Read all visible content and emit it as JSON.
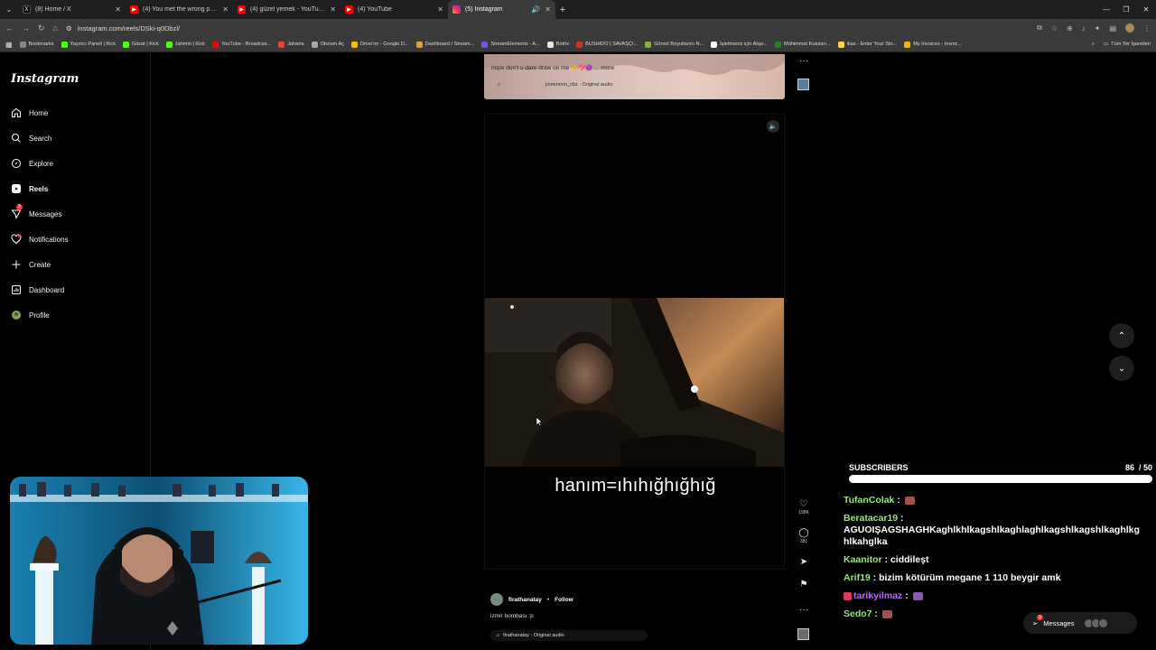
{
  "browser": {
    "tabs": [
      {
        "label": "(8) Home / X",
        "icon": "x-logo-icon",
        "color": "#000000"
      },
      {
        "label": "(4) You met the wrong person.",
        "icon": "youtube-icon",
        "color": "#ff0000"
      },
      {
        "label": "(4) güzel yemek - YouTube",
        "icon": "youtube-icon",
        "color": "#ff0000"
      },
      {
        "label": "(4) YouTube",
        "icon": "youtube-icon",
        "color": "#ff0000"
      },
      {
        "label": "(5) Instagram",
        "icon": "instagram-icon",
        "color": "#e1306c"
      }
    ],
    "url": "instagram.com/reels/DSki-q0Dbzl/",
    "bookmarks": [
      {
        "label": "Bookmarks",
        "color": "#888888"
      },
      {
        "label": "Yayıncı Paneli | Kick",
        "color": "#53fc18"
      },
      {
        "label": "Gitzat | Kick",
        "color": "#53fc18"
      },
      {
        "label": "Jahmin | Kick",
        "color": "#53fc18"
      },
      {
        "label": "YouTube - Broadcas...",
        "color": "#ff0000"
      },
      {
        "label": "Jaharia",
        "color": "#e0473c"
      },
      {
        "label": "Oturum Aç",
        "color": "#aaaaaa"
      },
      {
        "label": "Drive'ım - Google D...",
        "color": "#fbbc04"
      },
      {
        "label": "Dashboard / Stream...",
        "color": "#d9a441"
      },
      {
        "label": "StreamElements - A...",
        "color": "#6b5bd6"
      },
      {
        "label": "Botrix",
        "color": "#e6e6e6"
      },
      {
        "label": "BUSHIDO | SAVAŞÇI...",
        "color": "#c0392b"
      },
      {
        "label": "Görsel Boyutlarını N...",
        "color": "#7cb342"
      },
      {
        "label": "İşletmeniz için Alışv...",
        "color": "#ffffff"
      },
      {
        "label": "Mühimmat Kutuları...",
        "color": "#2e7d32"
      },
      {
        "label": "ikas - Enter Your Sto...",
        "color": "#ffd54f"
      },
      {
        "label": "My Invoices - Invoic...",
        "color": "#f4b400"
      }
    ],
    "bookmarks_right": "Tüm Yer İşaretleri"
  },
  "sidebar": {
    "logo": "Instagram",
    "items": [
      {
        "label": "Home",
        "icon": "home-icon"
      },
      {
        "label": "Search",
        "icon": "search-icon"
      },
      {
        "label": "Explore",
        "icon": "compass-icon"
      },
      {
        "label": "Reels",
        "icon": "reels-icon",
        "active": true
      },
      {
        "label": "Messages",
        "icon": "messenger-icon",
        "badge": "3"
      },
      {
        "label": "Notifications",
        "icon": "heart-icon"
      },
      {
        "label": "Create",
        "icon": "plus-icon"
      },
      {
        "label": "Dashboard",
        "icon": "dashboard-icon"
      },
      {
        "label": "Profile",
        "icon": "profile-avatar"
      }
    ]
  },
  "prev_reel": {
    "caption": "nope don't u dare draw on me 🤞💖🟣 ... more",
    "audio_user": "jinnnnnnn_cbz",
    "audio": "Original audio"
  },
  "reel": {
    "subtitle": "hanım=ıhıhığhığhığ",
    "username": "firathanatay",
    "separator": "•",
    "follow": "Follow",
    "caption": "izmir bombası :p",
    "audio": "firathanatay · Original audio",
    "likes": "198K",
    "comments": "381"
  },
  "overlay": {
    "subs_label": "SUBSCRIBERS",
    "subs_count": "86",
    "subs_goal": "/ 50",
    "subs_fill": 1.0,
    "chat": [
      {
        "user": "TufanColak",
        "text": "",
        "color": "#9be37a",
        "emote": true
      },
      {
        "user": "Beratacar19",
        "text": "AGUOIŞAGSHAGHKaghlkhlkagshlkaghlaghlkagshlkagshlkaghlkghlkahglka",
        "color": "#9be37a",
        "emote": false
      },
      {
        "user": "Kaanitor",
        "text": "ciddileşt",
        "color": "#9be37a",
        "emote": false
      },
      {
        "user": "Arif19",
        "text": "bizim kötürüm megane 1 110 beygir amk",
        "color": "#9be37a",
        "emote": false
      },
      {
        "user": "tarikyilmaz",
        "text": "",
        "color": "#b46cff",
        "emote": true
      },
      {
        "user": "Sedo7",
        "text": "",
        "color": "#9be37a",
        "emote": true
      }
    ],
    "messages_pill": "Messages",
    "messages_badge": "3"
  }
}
